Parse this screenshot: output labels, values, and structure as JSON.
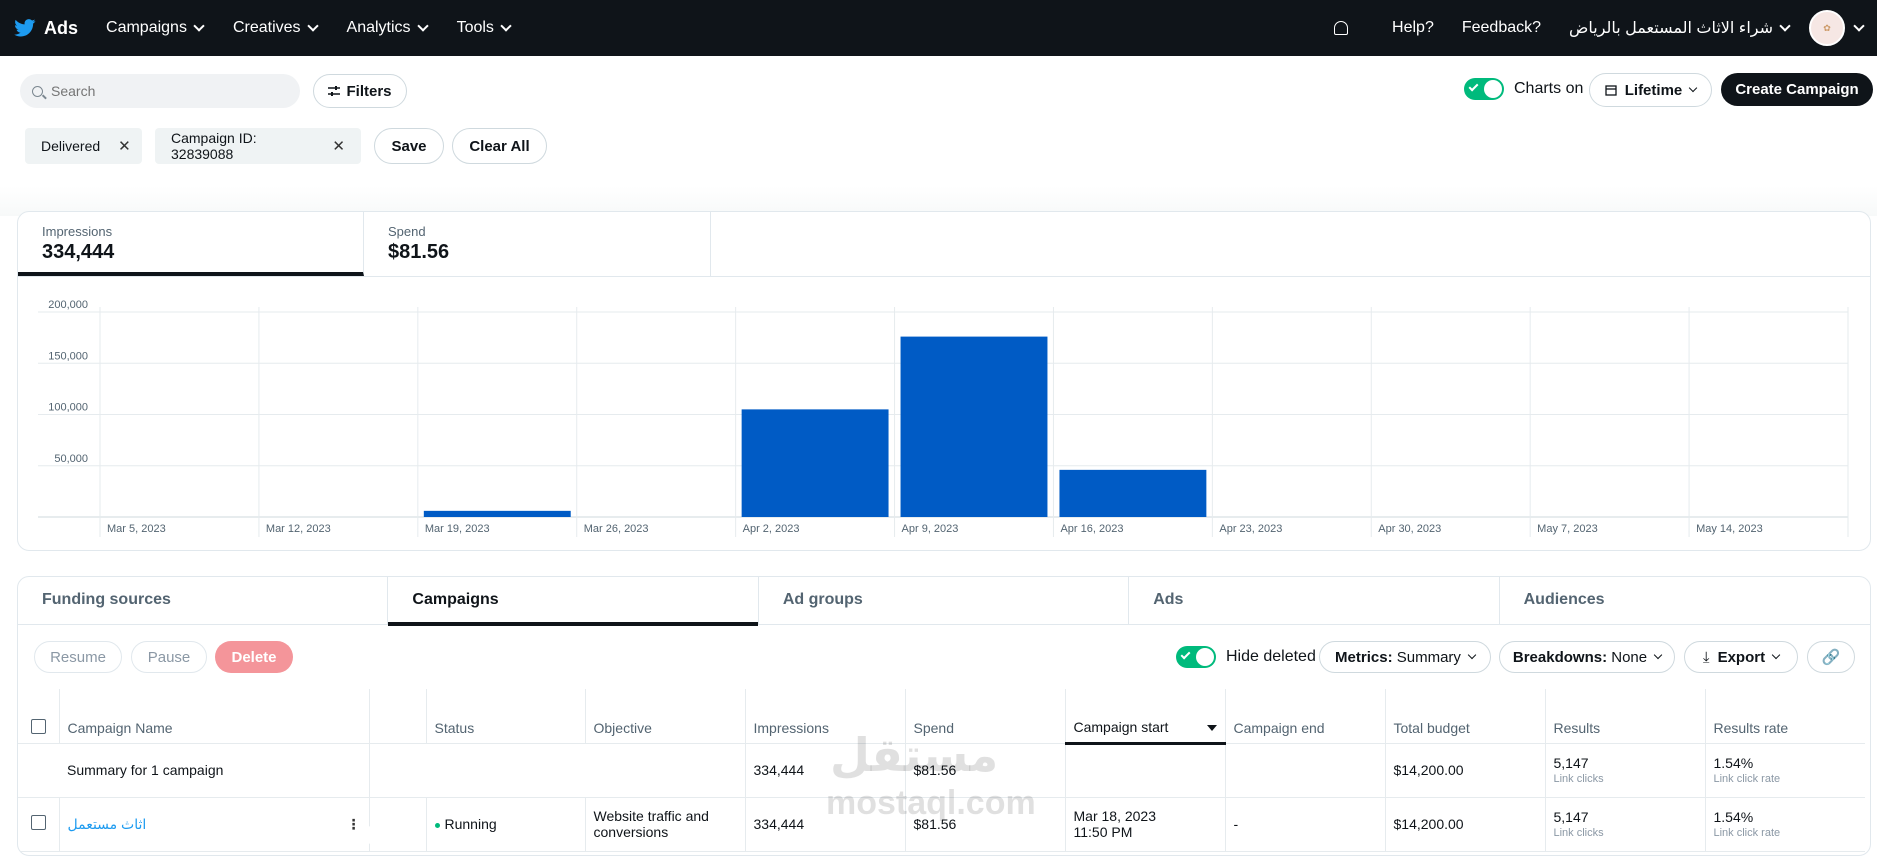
{
  "topbar": {
    "logo_text": "Ads",
    "nav": [
      {
        "label": "Campaigns"
      },
      {
        "label": "Creatives"
      },
      {
        "label": "Analytics"
      },
      {
        "label": "Tools"
      }
    ],
    "help": "Help?",
    "feedback": "Feedback?",
    "account_name": "شراء الاثاث المستعمل بالرياض"
  },
  "toolbar": {
    "search_placeholder": "Search",
    "filters_label": "Filters",
    "chips": [
      {
        "label": "Delivered"
      },
      {
        "label": "Campaign ID: 32839088"
      }
    ],
    "save_label": "Save",
    "clear_all_label": "Clear All",
    "charts_label": "Charts on",
    "lifetime_label": "Lifetime",
    "create_campaign_label": "Create Campaign"
  },
  "metrics": {
    "impressions_label": "Impressions",
    "impressions_value": "334,444",
    "spend_label": "Spend",
    "spend_value": "$81.56"
  },
  "chart_data": {
    "type": "bar",
    "categories": [
      "Mar 5, 2023",
      "Mar 12, 2023",
      "Mar 19, 2023",
      "Mar 26, 2023",
      "Apr 2, 2023",
      "Apr 9, 2023",
      "Apr 16, 2023",
      "Apr 23, 2023",
      "Apr 30, 2023",
      "May 7, 2023",
      "May 14, 2023"
    ],
    "values": [
      0,
      0,
      6000,
      0,
      105000,
      176000,
      46000,
      0,
      0,
      0,
      0
    ],
    "ylim": [
      0,
      200000
    ],
    "yticks": [
      50000,
      100000,
      150000,
      200000
    ],
    "ytick_labels": [
      "50,000",
      "100,000",
      "150,000",
      "200,000"
    ],
    "color": "#005bc5",
    "grid": true
  },
  "tabs": [
    {
      "label": "Funding sources"
    },
    {
      "label": "Campaigns"
    },
    {
      "label": "Ad groups"
    },
    {
      "label": "Ads"
    },
    {
      "label": "Audiences"
    }
  ],
  "actions": {
    "resume": "Resume",
    "pause": "Pause",
    "delete": "Delete",
    "hide_deleted": "Hide deleted",
    "metrics_label": "Metrics:",
    "metrics_value": "Summary",
    "breakdowns_label": "Breakdowns:",
    "breakdowns_value": "None",
    "export": "Export"
  },
  "table": {
    "headers": {
      "name": "Campaign Name",
      "status": "Status",
      "objective": "Objective",
      "impressions": "Impressions",
      "spend": "Spend",
      "start": "Campaign start",
      "end": "Campaign end",
      "budget": "Total budget",
      "results": "Results",
      "results_rate": "Results rate"
    },
    "summary": {
      "name": "Summary for 1 campaign",
      "impressions": "334,444",
      "spend": "$81.56",
      "budget": "$14,200.00",
      "results": "5,147",
      "results_sub": "Link clicks",
      "rate": "1.54%",
      "rate_sub": "Link click rate"
    },
    "row": {
      "name": "اثاث مستعمل",
      "status": "Running",
      "objective": "Website traffic and conversions",
      "impressions": "334,444",
      "spend": "$81.56",
      "start": "Mar 18, 2023",
      "start_time": "11:50 PM",
      "end": "-",
      "budget": "$14,200.00",
      "results": "5,147",
      "results_sub": "Link clicks",
      "rate": "1.54%",
      "rate_sub": "Link click rate"
    }
  },
  "watermark": {
    "arabic": "مستقل",
    "latin": "mostaql.com"
  }
}
